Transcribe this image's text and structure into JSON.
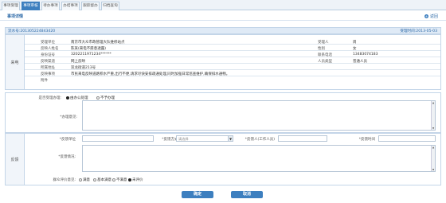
{
  "tabs": [
    "事项受理",
    "事项审核",
    "待办事项",
    "办结事项",
    "跟踪督办",
    "归档查询"
  ],
  "header": {
    "title": "事项详情",
    "return_label": "返回"
  },
  "record": {
    "number_label": "流水号:",
    "number": "201305224843420",
    "time_label": "受理时间:",
    "time": "2013-05-03"
  },
  "info_section": {
    "side_label": "来电",
    "rows": [
      {
        "l1": "受理单位",
        "v1": "南京市大众市政管理大队维修站点",
        "l2": "受理人",
        "v2": "周"
      },
      {
        "l1": "反映人姓名",
        "v1": "陈某(来电不愿意透露)",
        "l2": "性别",
        "v2": "女"
      },
      {
        "l1": "身份证号",
        "v1": "3202211971234******",
        "l2": "联系电话",
        "v2": "13483074183"
      },
      {
        "l1": "反映渠道",
        "v1": "网上反映",
        "l2": "人员类型",
        "v2": "普通人员"
      },
      {
        "l1": "所属地址",
        "v1": "双龙街道213号"
      },
      {
        "l1": "反映事项",
        "v1": "市民来电反映道路积水严重,出行不便,请求尽快安排疏通处理,同时加强日常巡查维护,确保排水通畅。"
      },
      {
        "l1": "附件",
        "v1": ""
      }
    ]
  },
  "process_section": {
    "accept_label": "是否受理办理:",
    "accept_options": [
      "由办公处理",
      "不予办理"
    ],
    "opinion_label": "*办理意见:"
  },
  "feedback_section": {
    "side_label": "反馈",
    "unit_label": "*反馈单位",
    "method_label": "*反馈方式:",
    "method_value": "请选择",
    "person_label": "*反馈人(工作人员)",
    "time_label": "*反馈时间",
    "content_label": "*反馈情况:",
    "satisfaction_label": "群众评价意见:",
    "satisfaction_options": [
      "满意",
      "基本满意",
      "不满意",
      "未评价"
    ]
  },
  "buttons": {
    "confirm": "确定",
    "cancel": "取消"
  },
  "colors": {
    "accent": "#3d7fbf",
    "title": "#2d6aa8"
  }
}
